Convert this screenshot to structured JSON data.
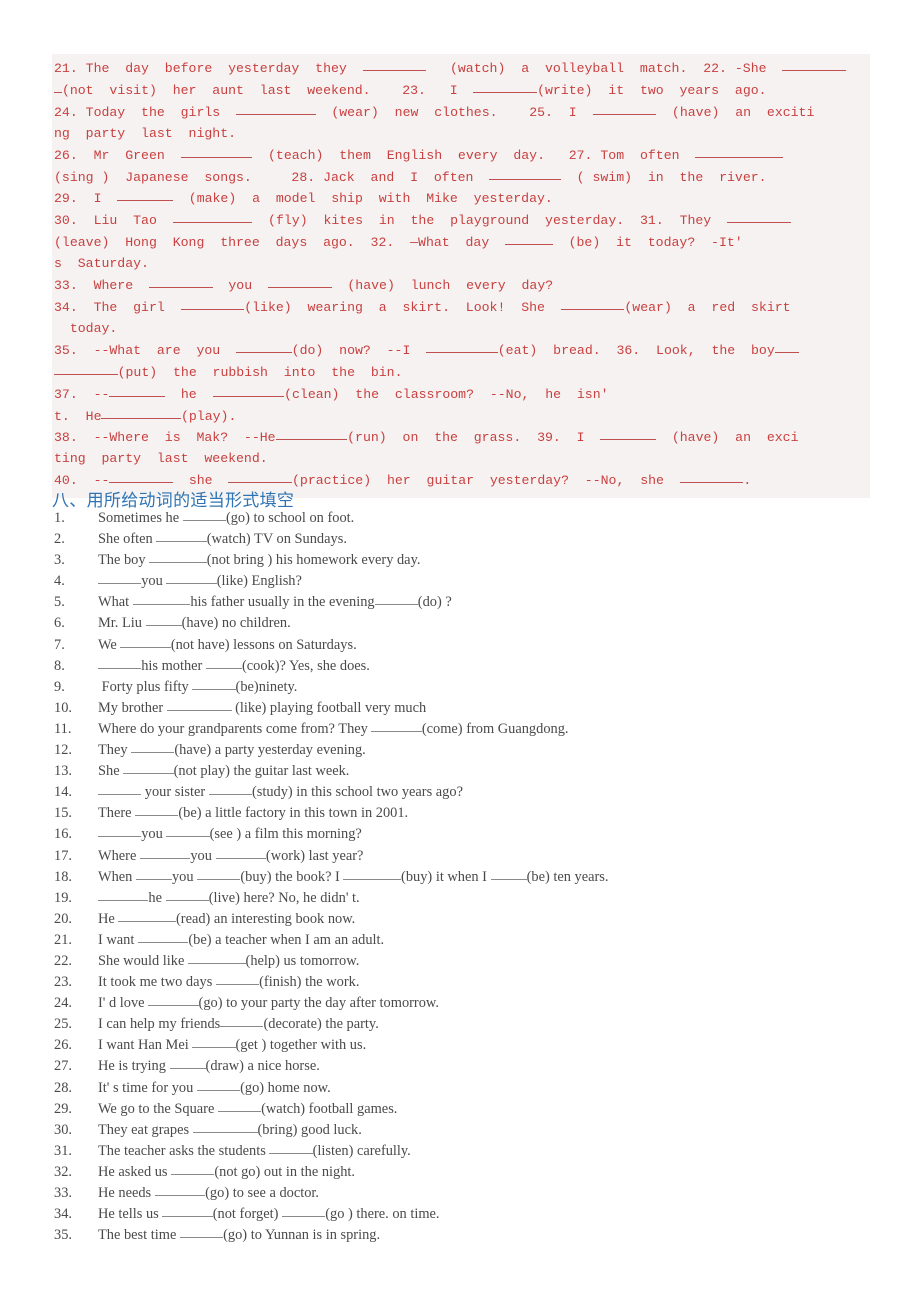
{
  "document": {
    "red_block": {
      "lines": [
        "21. The  day  before  yesterday  they  ________   (watch)  a  volleyball  match.  22. -She  ________",
        "_(not  visit)  her  aunt  last  weekend.    23.   I  ________(write)  it  two  years  ago.",
        "24. Today  the  girls  __________  (wear)  new  clothes.    25.  I  ________  (have)  an  exciti",
        "ng  party  last  night.",
        "26.  Mr  Green  _________  (teach)  them  English  every  day.   27. Tom  often  ___________",
        "(sing )  Japanese  songs.     28. Jack  and  I  often  _________  ( swim)  in  the  river.",
        "29.  I  _______  (make)  a  model  ship  with  Mike  yesterday.",
        "30.  Liu  Tao  __________  (fly)  kites  in  the  playground  yesterday.  31.  They  ________",
        "(leave)  Hong  Kong  three  days  ago.  32.  —What  day  ______  (be)  it  today?  -It'",
        "s  Saturday.",
        "33.  Where  ________  you  ________  (have)  lunch  every  day?",
        "34.  The  girl  ________(like)  wearing  a  skirt.  Look!  She  ________(wear)  a  red  skirt",
        "  today.",
        "35.  --What  are  you  _______(do)  now?  --I  _________(eat)  bread.  36.  Look,  the  boy___",
        "________(put)  the  rubbish  into  the  bin.",
        "37.  --_______  he  _________(clean)  the  classroom?  --No,  he  isn'",
        "t.  He__________(play).",
        "38.  --Where  is  Mak?  --He_________(run)  on  the  grass.  39.  I  _______  (have)  an  exci",
        "ting  party  last  weekend.",
        "40.  --________  she  ________(practice)  her  guitar  yesterday?  --No,  she  ________."
      ]
    },
    "section": {
      "heading": "八、用所给动词的适当形式填空",
      "items": [
        {
          "num": "1.",
          "text": "Sometimes he ______(go) to school on foot."
        },
        {
          "num": "2.",
          "text": "She often _______(watch) TV on Sundays."
        },
        {
          "num": "3.",
          "text": "The boy ________(not bring ) his homework every day."
        },
        {
          "num": "4.",
          "text": "______you _______(like) English?"
        },
        {
          "num": "5.",
          "text": "What ________his father usually in the evening______(do) ?"
        },
        {
          "num": "6.",
          "text": "Mr. Liu _____(have) no children."
        },
        {
          "num": "7.",
          "text": "We _______(not have) lessons on Saturdays."
        },
        {
          "num": "8.",
          "text": "______his mother _____(cook)? Yes, she does."
        },
        {
          "num": "9.",
          "text": " Forty plus fifty ______(be)ninety."
        },
        {
          "num": "10.",
          "text": "My brother _________ (like) playing football very much"
        },
        {
          "num": "11.",
          "text": "Where do your grandparents come from? They _______(come) from Guangdong."
        },
        {
          "num": "12.",
          "text": "They ______(have) a party yesterday evening."
        },
        {
          "num": "13.",
          "text": "She _______(not play) the guitar last week."
        },
        {
          "num": "14.",
          "text": "______ your sister ______(study) in this school two years ago?"
        },
        {
          "num": "15.",
          "text": "There ______(be) a little factory in this town in 2001."
        },
        {
          "num": "16.",
          "text": "______you ______(see ) a film this morning?"
        },
        {
          "num": "17.",
          "text": "Where _______you _______(work) last year?"
        },
        {
          "num": "18.",
          "text": "When _____you ______(buy) the book? I ________(buy) it when I _____(be) ten years."
        },
        {
          "num": "19.",
          "text": "_______he ______(live) here? No, he didn' t."
        },
        {
          "num": "20.",
          "text": "He ________(read) an interesting book now."
        },
        {
          "num": "21.",
          "text": "I want _______(be) a teacher when I am an adult."
        },
        {
          "num": "22.",
          "text": "She would like ________(help) us tomorrow."
        },
        {
          "num": "23.",
          "text": "It took me two days ______(finish) the work."
        },
        {
          "num": "24.",
          "text": "I' d love _______(go) to your party the day after tomorrow."
        },
        {
          "num": "25.",
          "text": "I can help my friends______(decorate) the party."
        },
        {
          "num": "26.",
          "text": "I want Han Mei ______(get ) together with us."
        },
        {
          "num": "27.",
          "text": "He is trying _____(draw) a nice horse."
        },
        {
          "num": "28.",
          "text": "It' s time for you ______(go) home now."
        },
        {
          "num": "29.",
          "text": "We go to the Square ______(watch) football games."
        },
        {
          "num": "30.",
          "text": "They eat grapes _________(bring) good luck."
        },
        {
          "num": "31.",
          "text": "The teacher asks the students ______(listen) carefully."
        },
        {
          "num": "32.",
          "text": "He asked us ______(not go) out in the night."
        },
        {
          "num": "33.",
          "text": "He needs _______(go) to see a doctor."
        },
        {
          "num": "34.",
          "text": "He tells us _______(not forget) ______(go ) there. on time."
        },
        {
          "num": "35.",
          "text": "The best time ______(go) to Yunnan is in spring."
        }
      ]
    },
    "colors": {
      "red_text": "#c94040",
      "red_block_bg": "#f5f2f1",
      "heading_blue": "#2e74b5",
      "body_text": "#4a4a4a"
    }
  }
}
